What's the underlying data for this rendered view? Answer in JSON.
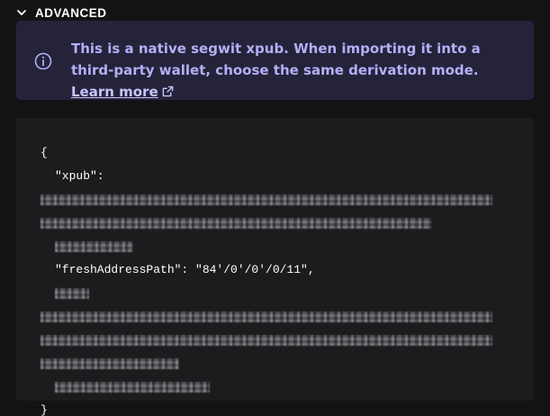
{
  "section": {
    "title": "ADVANCED",
    "chevron_icon": "chevron-down-icon"
  },
  "info": {
    "icon": "info-circle-icon",
    "text": "This is a native segwit xpub. When importing it into a third-party wallet, choose the same derivation mode.",
    "link_label": "Learn more",
    "link_icon": "external-link-icon",
    "text_color": "#b6aef5",
    "background": "#24233a"
  },
  "code": {
    "open_brace": "{",
    "xpub_key": "\"xpub\":",
    "fresh_address_path_line": "\"freshAddressPath\": \"84'/0'/0'/0/11\",",
    "close_brace": "}",
    "redacted": "redacted-text"
  }
}
